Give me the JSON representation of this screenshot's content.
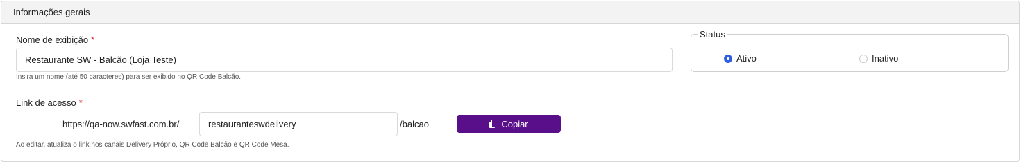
{
  "section": {
    "title": "Informações gerais"
  },
  "display_name": {
    "label": "Nome de exibição",
    "required_mark": "*",
    "value": "Restaurante SW - Balcão (Loja Teste)",
    "help": "Insira um nome (até 50 caracteres) para ser exibido no QR Code Balcão."
  },
  "access_link": {
    "label": "Link de acesso",
    "required_mark": "*",
    "prefix": "https://qa-now.swfast.com.br/",
    "slug_value": "restauranteswdelivery",
    "suffix": "/balcao",
    "copy_label": "Copiar",
    "copy_icon": "copy-icon",
    "help": "Ao editar, atualiza o link nos canais Delivery Próprio, QR Code Balcão e QR Code Mesa."
  },
  "status": {
    "legend": "Status",
    "options": [
      {
        "label": "Ativo",
        "checked": true
      },
      {
        "label": "Inativo",
        "checked": false
      }
    ]
  },
  "colors": {
    "primary_button": "#5a0f8a",
    "radio_selected": "#2f5fe0",
    "required": "#d9262a"
  }
}
